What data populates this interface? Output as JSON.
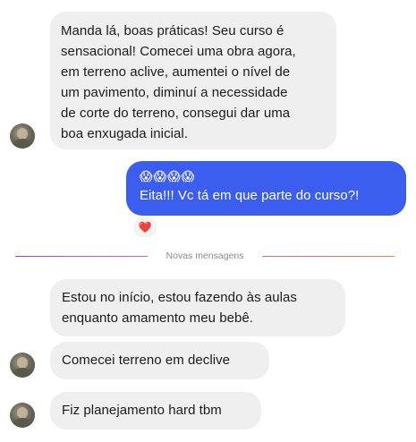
{
  "messages": {
    "incoming_1": {
      "lines": [
        "Manda lá, boas práticas! Seu curso é",
        "sensacional! Comecei uma obra agora,",
        "em terreno aclive, aumentei o nível de",
        "um pavimento, diminuí a necessidade",
        "de corte do terreno, consegui dar uma",
        "boa enxugada inicial."
      ]
    },
    "outgoing_1": {
      "emoji": "😱😱😱😱",
      "text": "Eita!!! Vc tá em que parte do curso?!",
      "reaction": "❤️"
    },
    "divider": {
      "label": "Novas mensagens"
    },
    "incoming_2": {
      "lines": [
        "Estou no início, estou fazendo às aulas",
        "enquanto amamento meu bebê."
      ]
    },
    "incoming_3": {
      "text": "Comecei terreno em declive"
    },
    "incoming_4": {
      "text": "Fiz planejamento hard tbm"
    }
  },
  "colors": {
    "incoming_bubble": "#efefef",
    "outgoing_bubble": "#3b5df0",
    "divider_gradient_start": "#8e3fe0",
    "divider_gradient_end": "#ea8b4f"
  }
}
